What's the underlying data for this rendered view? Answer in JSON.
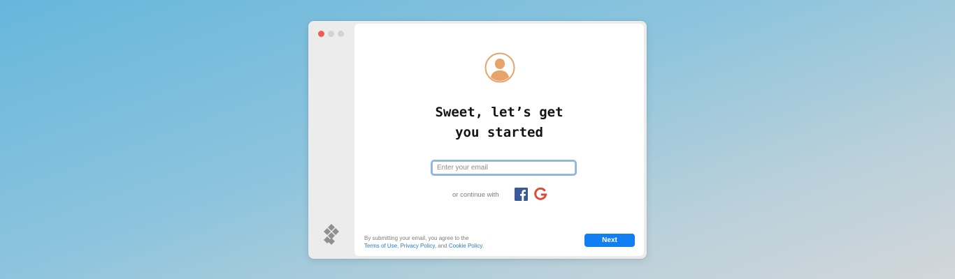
{
  "window": {
    "traffic_lights": [
      "close",
      "minimize",
      "zoom"
    ]
  },
  "sidebar": {
    "logo_icon": "diamond-grid-logo-icon"
  },
  "onboarding": {
    "avatar_icon": "user-avatar-icon",
    "title_line1": "Sweet, let’s get",
    "title_line2": "you started",
    "email_placeholder": "Enter your email",
    "email_value": "",
    "continue_label": "or continue with",
    "social": [
      {
        "name": "facebook",
        "icon": "facebook-icon",
        "color": "#3b5998"
      },
      {
        "name": "google",
        "icon": "google-icon",
        "color": "#dd4b39"
      }
    ],
    "legal": {
      "prefix": "By submitting your email, you agree to the",
      "terms": "Terms of Use",
      "sep1": ",",
      "privacy": "Privacy Policy",
      "sep2": ", and",
      "cookie": "Cookie Policy",
      "suffix": "."
    },
    "next_label": "Next"
  },
  "colors": {
    "accent": "#127ef3",
    "link": "#1f7bd6",
    "avatar": "#e8a36a",
    "close_light": "#ee5b50"
  }
}
